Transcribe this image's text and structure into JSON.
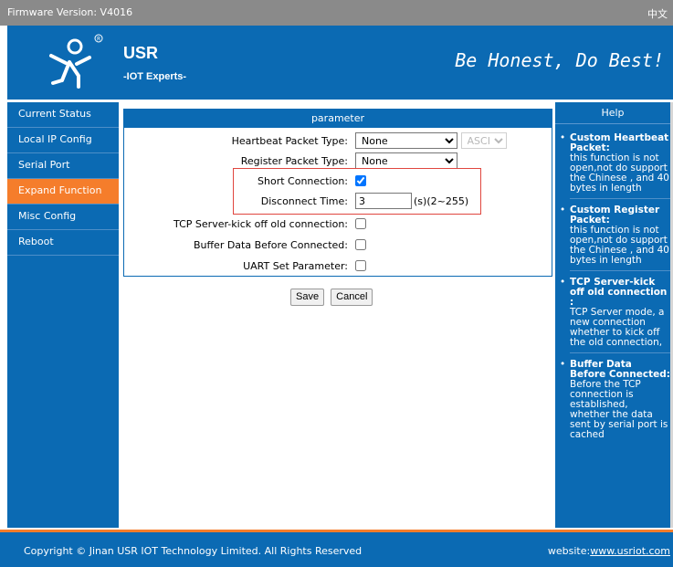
{
  "topbar": {
    "firmware": "Firmware Version: V4016",
    "lang_link": "中文"
  },
  "header": {
    "brand": "USR",
    "brand_sub": "-IOT Experts-",
    "slogan": "Be Honest, Do Best!"
  },
  "sidebar": {
    "items": [
      {
        "label": "Current Status",
        "active": false
      },
      {
        "label": "Local IP Config",
        "active": false
      },
      {
        "label": "Serial Port",
        "active": false
      },
      {
        "label": "Expand Function",
        "active": true
      },
      {
        "label": "Misc Config",
        "active": false
      },
      {
        "label": "Reboot",
        "active": false
      }
    ]
  },
  "panel": {
    "title": "parameter",
    "heartbeat": {
      "label": "Heartbeat Packet Type:",
      "value": "None",
      "format": "ASCII"
    },
    "register": {
      "label": "Register Packet Type:",
      "value": "None"
    },
    "short_conn": {
      "label": "Short Connection:",
      "checked": true
    },
    "disconnect": {
      "label": "Disconnect Time:",
      "value": "3",
      "hint": "(s)(2~255)"
    },
    "kickoff": {
      "label": "TCP Server-kick off old connection:",
      "checked": false
    },
    "buffer": {
      "label": "Buffer Data Before Connected:",
      "checked": false
    },
    "uart": {
      "label": "UART Set Parameter:",
      "checked": false
    }
  },
  "buttons": {
    "save": "Save",
    "cancel": "Cancel"
  },
  "help": {
    "title": "Help",
    "items": [
      {
        "title": "Custom Heartbeat Packet:",
        "text": "this function is not open,not do support the Chinese , and 40 bytes in length"
      },
      {
        "title": "Custom Register Packet:",
        "text": "this function is not open,not do support the Chinese , and 40 bytes in length"
      },
      {
        "title": "TCP Server-kick off old connection :",
        "text": "TCP Server mode, a new connection whether to kick off the old connection,"
      },
      {
        "title": "Buffer Data Before Connected:",
        "text": "Before the TCP connection is established, whether the data sent by serial port is cached"
      }
    ]
  },
  "footer": {
    "copyright": "Copyright © Jinan USR IOT Technology Limited. All Rights Reserved",
    "site_label": "website:",
    "site_link": "www.usriot.com"
  },
  "colors": {
    "primary": "#0b6ab3",
    "accent": "#f57d2b",
    "topbar": "#8a8a8a",
    "highlight_border": "#e0463f"
  }
}
